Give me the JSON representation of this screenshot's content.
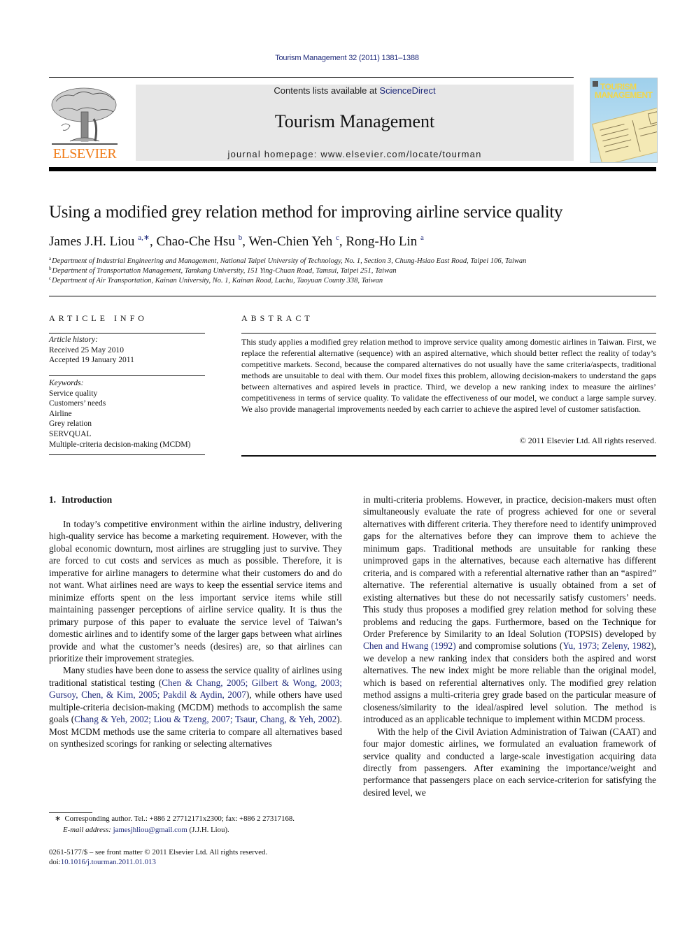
{
  "header": {
    "journal_ref": "Tourism Management 32 (2011) 1381–1388",
    "contents_prefix": "Contents lists available at ",
    "contents_link": "ScienceDirect",
    "journal_title": "Tourism Management",
    "homepage": "journal homepage: www.elsevier.com/locate/tourman",
    "publisher_logo_text": "ELSEVIER",
    "cover_title_line1": "TOURISM",
    "cover_title_line2": "MANAGEMENT",
    "colors": {
      "link": "#1f2a7a",
      "elsevier_orange": "#f07d1a",
      "masthead_bg": "#e7e7e7"
    }
  },
  "article": {
    "title": "Using a modified grey relation method for improving airline service quality",
    "authors": [
      {
        "name": "James J.H. Liou",
        "sup": "a,∗",
        "sep": ", "
      },
      {
        "name": "Chao-Che Hsu",
        "sup": "b",
        "sep": ", "
      },
      {
        "name": "Wen-Chien Yeh",
        "sup": "c",
        "sep": ", "
      },
      {
        "name": "Rong-Ho Lin",
        "sup": "a",
        "sep": ""
      }
    ],
    "affiliations": [
      {
        "key": "a",
        "text": "Department of Industrial Engineering and Management, National Taipei University of Technology, No. 1, Section 3, Chung-Hsiao East Road, Taipei 106, Taiwan"
      },
      {
        "key": "b",
        "text": "Department of Transportation Management, Tamkang University, 151 Ying-Chuan Road, Tamsui, Taipei 251, Taiwan"
      },
      {
        "key": "c",
        "text": "Department of Air Transportation, Kainan University, No. 1, Kainan Road, Luchu, Taoyuan County 338, Taiwan"
      }
    ]
  },
  "article_info": {
    "heading": "ARTICLE INFO",
    "history_label": "Article history:",
    "received": "Received 25 May 2010",
    "accepted": "Accepted 19 January 2011",
    "keywords_label": "Keywords:",
    "keywords": [
      "Service quality",
      "Customers’ needs",
      "Airline",
      "Grey relation",
      "SERVQUAL",
      "Multiple-criteria decision-making (MCDM)"
    ]
  },
  "abstract": {
    "heading": "ABSTRACT",
    "text": "This study applies a modified grey relation method to improve service quality among domestic airlines in Taiwan. First, we replace the referential alternative (sequence) with an aspired alternative, which should better reflect the reality of today’s competitive markets. Second, because the compared alternatives do not usually have the same criteria/aspects, traditional methods are unsuitable to deal with them. Our model fixes this problem, allowing decision-makers to understand the gaps between alternatives and aspired levels in practice. Third, we develop a new ranking index to measure the airlines’ competitive­ness in terms of service quality. To validate the effectiveness of our model, we conduct a large sample survey. We also provide managerial improvements needed by each carrier to achieve the aspired level of customer satisfaction.",
    "copyright": "© 2011 Elsevier Ltd. All rights reserved."
  },
  "body": {
    "section_number": "1.",
    "section_title": "Introduction",
    "p1": "In today’s competitive environment within the airline industry, delivering high-quality service has become a marketing require­ment. However, with the global economic downturn, most airlines are struggling just to survive. They are forced to cut costs and services as much as possible. Therefore, it is imperative for airline managers to determine what their customers do and do not want. What airlines need are ways to keep the essential service items and minimize efforts spent on the less important service items while still maintaining passenger perceptions of airline service quality. It is thus the primary purpose of this paper to evaluate the service level of Taiwan’s domestic airlines and to identify some of the larger gaps between what airlines provide and what the customer’s needs (desires) are, so that airlines can prioritize their improvement strategies.",
    "p2_a": "Many studies have been done to assess the service quality of airlines using traditional statistical testing (",
    "p2_cite1": "Chen & Chang, 2005; Gilbert & Wong, 2003; Gursoy, Chen, & Kim, 2005; Pakdil & Aydin, 2007",
    "p2_b": "), while others have used multiple-criteria decision-making (MCDM) methods to accomplish the same goals (",
    "p2_cite2": "Chang & Yeh, 2002; Liou & Tzeng, 2007; Tsaur, Chang, & Yeh, 2002",
    "p2_c": "). Most MCDM methods use the same criteria to compare all alternatives based on synthesized scorings for ranking or selecting alternatives",
    "p3_a": "in multi-criteria problems. However, in practice, decision-makers must often simultaneously evaluate the rate of progress achieved for one or several alternatives with different criteria. They therefore need to identify unimproved gaps for the alternatives before they can improve them to achieve the minimum gaps. Traditional methods are unsuitable for ranking these unimproved gaps in the alternatives, because each alternative has different criteria, and is compared with a referential alternative rather than an “aspired” alternative. The referential alternative is usually obtained from a set of existing alternatives but these do not necessarily satisfy customers’ needs. This study thus proposes a modified grey relation method for solving these problems and reducing the gaps. Furthermore, based on the Technique for Order Preference by Similarity to an Ideal Solution (TOPSIS) developed by ",
    "p3_cite1": "Chen and Hwang (1992)",
    "p3_b": " and compromise solutions (",
    "p3_cite2": "Yu, 1973; Zeleny, 1982",
    "p3_c": "), we develop a new ranking index that considers both the aspired and worst alternatives. The new index might be more reliable than the original model, which is based on referential alternatives only. The modified grey relation method assigns a multi-criteria grey grade based on the particular measure of closeness/similarity to the ideal/aspired level solution. The method is introduced as an applicable technique to implement within MCDM process.",
    "p4": "With the help of the Civil Aviation Administration of Taiwan (CAAT) and four major domestic airlines, we formulated an evalu­ation framework of service quality and conducted a large-scale investigation acquiring data directly from passengers. After exam­ining the importance/weight and performance that passengers place on each service-criterion for satisfying the desired level, we"
  },
  "footnotes": {
    "corresponding_marker": "∗",
    "corresponding": "Corresponding author. Tel.: +886 2 27712171x2300; fax: +886 2 27317168.",
    "email_label": "E-mail address:",
    "email": "jamesjhliou@gmail.com",
    "email_owner": " (J.J.H. Liou).",
    "issn": "0261-5177/$ – see front matter © 2011 Elsevier Ltd. All rights reserved.",
    "doi_label": "doi:",
    "doi": "10.1016/j.tourman.2011.01.013"
  }
}
